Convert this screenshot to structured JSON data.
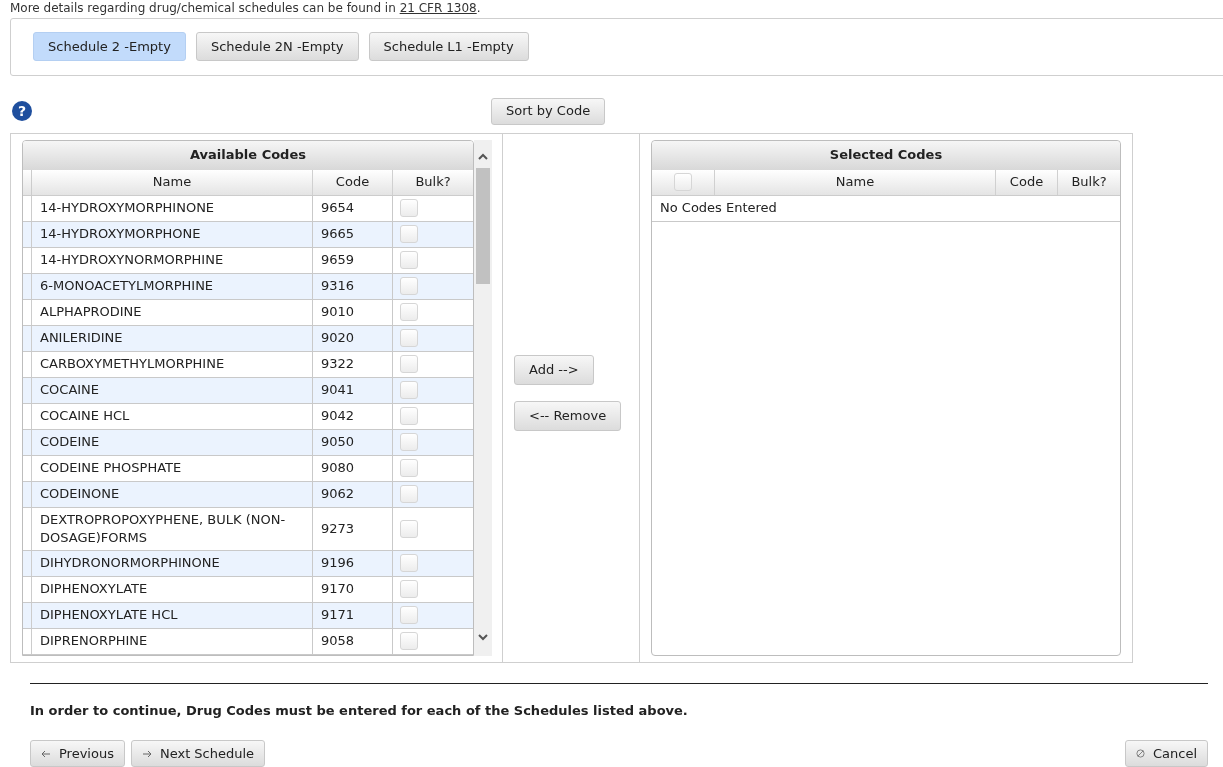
{
  "intro": {
    "text": "More details regarding drug/chemical schedules can be found in",
    "link": "21 CFR 1308",
    "end": "."
  },
  "schedules": [
    {
      "label": "Schedule 2 -Empty",
      "selected": true
    },
    {
      "label": "Schedule 2N -Empty",
      "selected": false
    },
    {
      "label": "Schedule L1 -Empty",
      "selected": false
    }
  ],
  "help_icon": "?",
  "sort_button": "Sort by Code",
  "available": {
    "title": "Available Codes",
    "columns": [
      "Name",
      "Code",
      "Bulk?"
    ],
    "rows": [
      {
        "name": "14-HYDROXYMORPHINONE",
        "code": "9654",
        "bulk": false
      },
      {
        "name": "14-HYDROXYMORPHONE",
        "code": "9665",
        "bulk": false
      },
      {
        "name": "14-HYDROXYNORMORPHINE",
        "code": "9659",
        "bulk": false
      },
      {
        "name": "6-MONOACETYLMORPHINE",
        "code": "9316",
        "bulk": false
      },
      {
        "name": "ALPHAPRODINE",
        "code": "9010",
        "bulk": false
      },
      {
        "name": "ANILERIDINE",
        "code": "9020",
        "bulk": false
      },
      {
        "name": "CARBOXYMETHYLMORPHINE",
        "code": "9322",
        "bulk": false
      },
      {
        "name": "COCAINE",
        "code": "9041",
        "bulk": false
      },
      {
        "name": "COCAINE HCL",
        "code": "9042",
        "bulk": false
      },
      {
        "name": "CODEINE",
        "code": "9050",
        "bulk": false
      },
      {
        "name": "CODEINE PHOSPHATE",
        "code": "9080",
        "bulk": false
      },
      {
        "name": "CODEINONE",
        "code": "9062",
        "bulk": false
      },
      {
        "name": "DEXTROPROPOXYPHENE, BULK (NON-DOSAGE)FORMS",
        "code": "9273",
        "bulk": false
      },
      {
        "name": "DIHYDRONORMORPHINONE",
        "code": "9196",
        "bulk": false
      },
      {
        "name": "DIPHENOXYLATE",
        "code": "9170",
        "bulk": false
      },
      {
        "name": "DIPHENOXYLATE HCL",
        "code": "9171",
        "bulk": false
      },
      {
        "name": "DIPRENORPHINE",
        "code": "9058",
        "bulk": false
      }
    ]
  },
  "add_button": "Add -->",
  "remove_button": "<-- Remove",
  "selected": {
    "title": "Selected Codes",
    "select_all": false,
    "columns": [
      "Name",
      "Code",
      "Bulk?"
    ],
    "empty": "No Codes Entered"
  },
  "message": "In order to continue, Drug Codes must be entered for each of the Schedules listed above.",
  "nav": {
    "previous": "Previous",
    "next": "Next Schedule",
    "cancel": "Cancel"
  }
}
